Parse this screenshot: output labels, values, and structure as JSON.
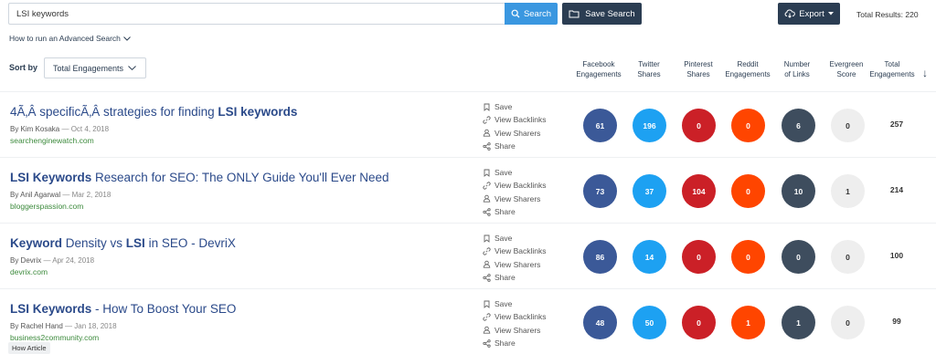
{
  "search": {
    "query": "LSI keywords",
    "button_label": "Search"
  },
  "toolbar": {
    "save_search_label": "Save Search",
    "export_label": "Export"
  },
  "total_results": "Total Results: 220",
  "advanced_search_label": "How to run an Advanced Search",
  "sort": {
    "label": "Sort by",
    "selected": "Total Engagements"
  },
  "columns": [
    {
      "line1": "Facebook",
      "line2": "Engagements"
    },
    {
      "line1": "Twitter",
      "line2": "Shares"
    },
    {
      "line1": "Pinterest",
      "line2": "Shares"
    },
    {
      "line1": "Reddit",
      "line2": "Engagements"
    },
    {
      "line1": "Number",
      "line2": "of Links"
    },
    {
      "line1": "Evergreen",
      "line2": "Score"
    },
    {
      "line1": "Total",
      "line2": "Engagements"
    }
  ],
  "actions": {
    "save": "Save",
    "backlinks": "View Backlinks",
    "sharers": "View Sharers",
    "share": "Share"
  },
  "colors": {
    "facebook": "#3b5998",
    "twitter": "#1da1f2",
    "pinterest": "#cb2027",
    "reddit": "#ff4500",
    "links": "#3e4d5e",
    "evergreen": "#eeeeee"
  },
  "results": [
    {
      "title_parts": [
        {
          "text": "4Ã‚Â specificÃ‚Â strategies for finding ",
          "bold": false
        },
        {
          "text": "LSI keywords",
          "bold": true
        }
      ],
      "author": "By Kim Kosaka",
      "date": " — Oct 4, 2018",
      "domain": "searchenginewatch.com",
      "metrics": [
        "61",
        "196",
        "0",
        "0",
        "6",
        "0"
      ],
      "total": "257",
      "tag": ""
    },
    {
      "title_parts": [
        {
          "text": "LSI Keywords",
          "bold": true
        },
        {
          "text": " Research for SEO: The ONLY Guide You'll Ever Need",
          "bold": false
        }
      ],
      "author": "By Anil Agarwal",
      "date": " — Mar 2, 2018",
      "domain": "bloggerspassion.com",
      "metrics": [
        "73",
        "37",
        "104",
        "0",
        "10",
        "1"
      ],
      "total": "214",
      "tag": ""
    },
    {
      "title_parts": [
        {
          "text": "Keyword",
          "bold": true
        },
        {
          "text": " Density vs ",
          "bold": false
        },
        {
          "text": "LSI",
          "bold": true
        },
        {
          "text": " in SEO - DevriX",
          "bold": false
        }
      ],
      "author": "By Devrix",
      "date": " — Apr 24, 2018",
      "domain": "devrix.com",
      "metrics": [
        "86",
        "14",
        "0",
        "0",
        "0",
        "0"
      ],
      "total": "100",
      "tag": ""
    },
    {
      "title_parts": [
        {
          "text": "LSI Keywords",
          "bold": true
        },
        {
          "text": " - How To Boost Your SEO",
          "bold": false
        }
      ],
      "author": "By Rachel Hand",
      "date": " — Jan 18, 2018",
      "domain": "business2community.com",
      "metrics": [
        "48",
        "50",
        "0",
        "1",
        "1",
        "0"
      ],
      "total": "99",
      "tag": "How Article"
    }
  ]
}
